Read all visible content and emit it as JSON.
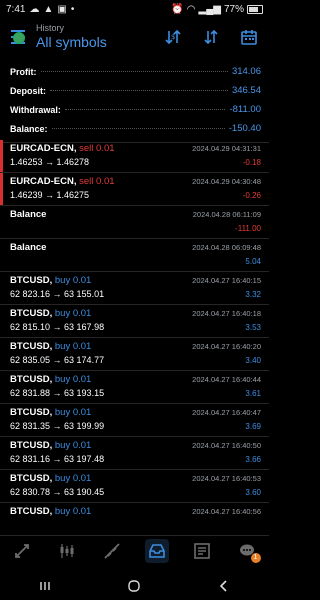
{
  "status": {
    "time": "7:41",
    "battery_pct": "77%"
  },
  "header": {
    "subtitle": "History",
    "title": "All symbols"
  },
  "summary": [
    {
      "label": "Profit:",
      "value": "314.06"
    },
    {
      "label": "Deposit:",
      "value": "346.54"
    },
    {
      "label": "Withdrawal:",
      "value": "-811.00"
    },
    {
      "label": "Balance:",
      "value": "-150.40"
    }
  ],
  "deals": [
    {
      "symbol": "EURCAD-ECN,",
      "side": "sell 0.01",
      "type": "sell",
      "time": "2024.04.29 04:31:31",
      "prices": "1.46253 → 1.46278",
      "profit": "-0.18"
    },
    {
      "symbol": "EURCAD-ECN,",
      "side": "sell 0.01",
      "type": "sell",
      "time": "2024.04.29 04:30:48",
      "prices": "1.46239 → 1.46275",
      "profit": "-0.26"
    },
    {
      "symbol": "Balance",
      "side": "",
      "type": "balance",
      "time": "2024.04.28 06:11:09",
      "prices": "",
      "profit": "-111.00"
    },
    {
      "symbol": "Balance",
      "side": "",
      "type": "balance",
      "time": "2024.04.28 06:09:48",
      "prices": "",
      "profit": "5.04"
    },
    {
      "symbol": "BTCUSD,",
      "side": "buy 0.01",
      "type": "buy",
      "time": "2024.04.27 16:40:15",
      "prices": "62 823.16 → 63 155.01",
      "profit": "3.32"
    },
    {
      "symbol": "BTCUSD,",
      "side": "buy 0.01",
      "type": "buy",
      "time": "2024.04.27 16:40:18",
      "prices": "62 815.10 → 63 167.98",
      "profit": "3.53"
    },
    {
      "symbol": "BTCUSD,",
      "side": "buy 0.01",
      "type": "buy",
      "time": "2024.04.27 16:40:20",
      "prices": "62 835.05 → 63 174.77",
      "profit": "3.40"
    },
    {
      "symbol": "BTCUSD,",
      "side": "buy 0.01",
      "type": "buy",
      "time": "2024.04.27 16:40:44",
      "prices": "62 831.88 → 63 193.15",
      "profit": "3.61"
    },
    {
      "symbol": "BTCUSD,",
      "side": "buy 0.01",
      "type": "buy",
      "time": "2024.04.27 16:40:47",
      "prices": "62 831.35 → 63 199.99",
      "profit": "3.69"
    },
    {
      "symbol": "BTCUSD,",
      "side": "buy 0.01",
      "type": "buy",
      "time": "2024.04.27 16:40:50",
      "prices": "62 831.16 → 63 197.48",
      "profit": "3.66"
    },
    {
      "symbol": "BTCUSD,",
      "side": "buy 0.01",
      "type": "buy",
      "time": "2024.04.27 16:40:53",
      "prices": "62 830.78 → 63 190.45",
      "profit": "3.60"
    },
    {
      "symbol": "BTCUSD,",
      "side": "buy 0.01",
      "type": "buy",
      "time": "2024.04.27 16:40:56",
      "prices": "",
      "profit": ""
    }
  ],
  "tabs": [
    {
      "name": "quotes-icon"
    },
    {
      "name": "chart-icon"
    },
    {
      "name": "trade-icon"
    },
    {
      "name": "history-icon"
    },
    {
      "name": "news-icon"
    },
    {
      "name": "messages-icon",
      "badge": "1"
    }
  ]
}
